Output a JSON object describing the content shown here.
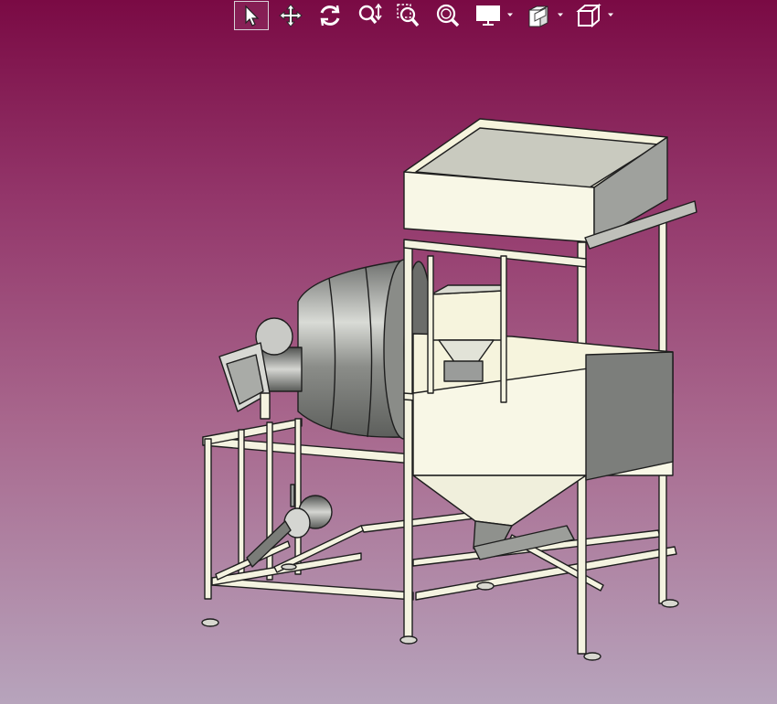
{
  "app": {
    "view": "3D model viewer"
  },
  "toolbar": {
    "tools": [
      {
        "icon": "select-arrow-icon",
        "active": true
      },
      {
        "icon": "pan-move-icon",
        "active": false
      },
      {
        "icon": "rotate-icon",
        "active": false
      },
      {
        "icon": "zoom-vertical-icon",
        "active": false
      },
      {
        "icon": "zoom-window-icon",
        "active": false
      },
      {
        "icon": "zoom-fit-icon",
        "active": false
      },
      {
        "icon": "display-mode-icon",
        "has_dropdown": true
      },
      {
        "icon": "section-view-icon",
        "has_dropdown": true
      },
      {
        "icon": "view-cube-icon",
        "has_dropdown": true
      }
    ]
  },
  "colors": {
    "background_top": "#7a0a44",
    "background_bottom": "#b7a4bc",
    "frame": "#f4f3e0",
    "edge": "#1e1e1e",
    "metal": "#9a9c9a"
  }
}
